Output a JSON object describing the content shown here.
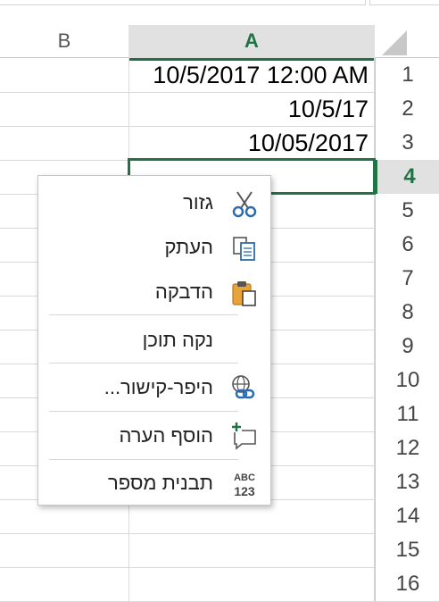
{
  "columns": {
    "b": "B",
    "a": "A"
  },
  "rows": [
    {
      "num": "1",
      "a": "10/5/2017 12:00 AM"
    },
    {
      "num": "2",
      "a": "10/5/17"
    },
    {
      "num": "3",
      "a": "10/05/2017"
    },
    {
      "num": "4",
      "a": ""
    },
    {
      "num": "5",
      "a": ""
    },
    {
      "num": "6",
      "a": ""
    },
    {
      "num": "7",
      "a": ""
    },
    {
      "num": "8",
      "a": ""
    },
    {
      "num": "9",
      "a": ""
    },
    {
      "num": "10",
      "a": ""
    },
    {
      "num": "11",
      "a": ""
    },
    {
      "num": "12",
      "a": ""
    },
    {
      "num": "13",
      "a": ""
    },
    {
      "num": "14",
      "a": ""
    },
    {
      "num": "15",
      "a": ""
    },
    {
      "num": "16",
      "a": ""
    }
  ],
  "selected_row": "4",
  "context_menu": {
    "items": [
      {
        "label": "גזור",
        "icon": "cut-icon"
      },
      {
        "label": "העתק",
        "icon": "copy-icon"
      },
      {
        "label": "הדבקה",
        "icon": "paste-icon"
      },
      {
        "label": "נקה תוכן",
        "icon": ""
      },
      {
        "label": "היפר-קישור...",
        "icon": "hyperlink-icon"
      },
      {
        "label": "הוסף הערה",
        "icon": "add-comment-icon"
      },
      {
        "label": "תבנית מספר",
        "icon": "number-format-icon"
      }
    ]
  },
  "colors": {
    "accent": "#217346",
    "header_selected_bg": "#e1e1e1"
  }
}
